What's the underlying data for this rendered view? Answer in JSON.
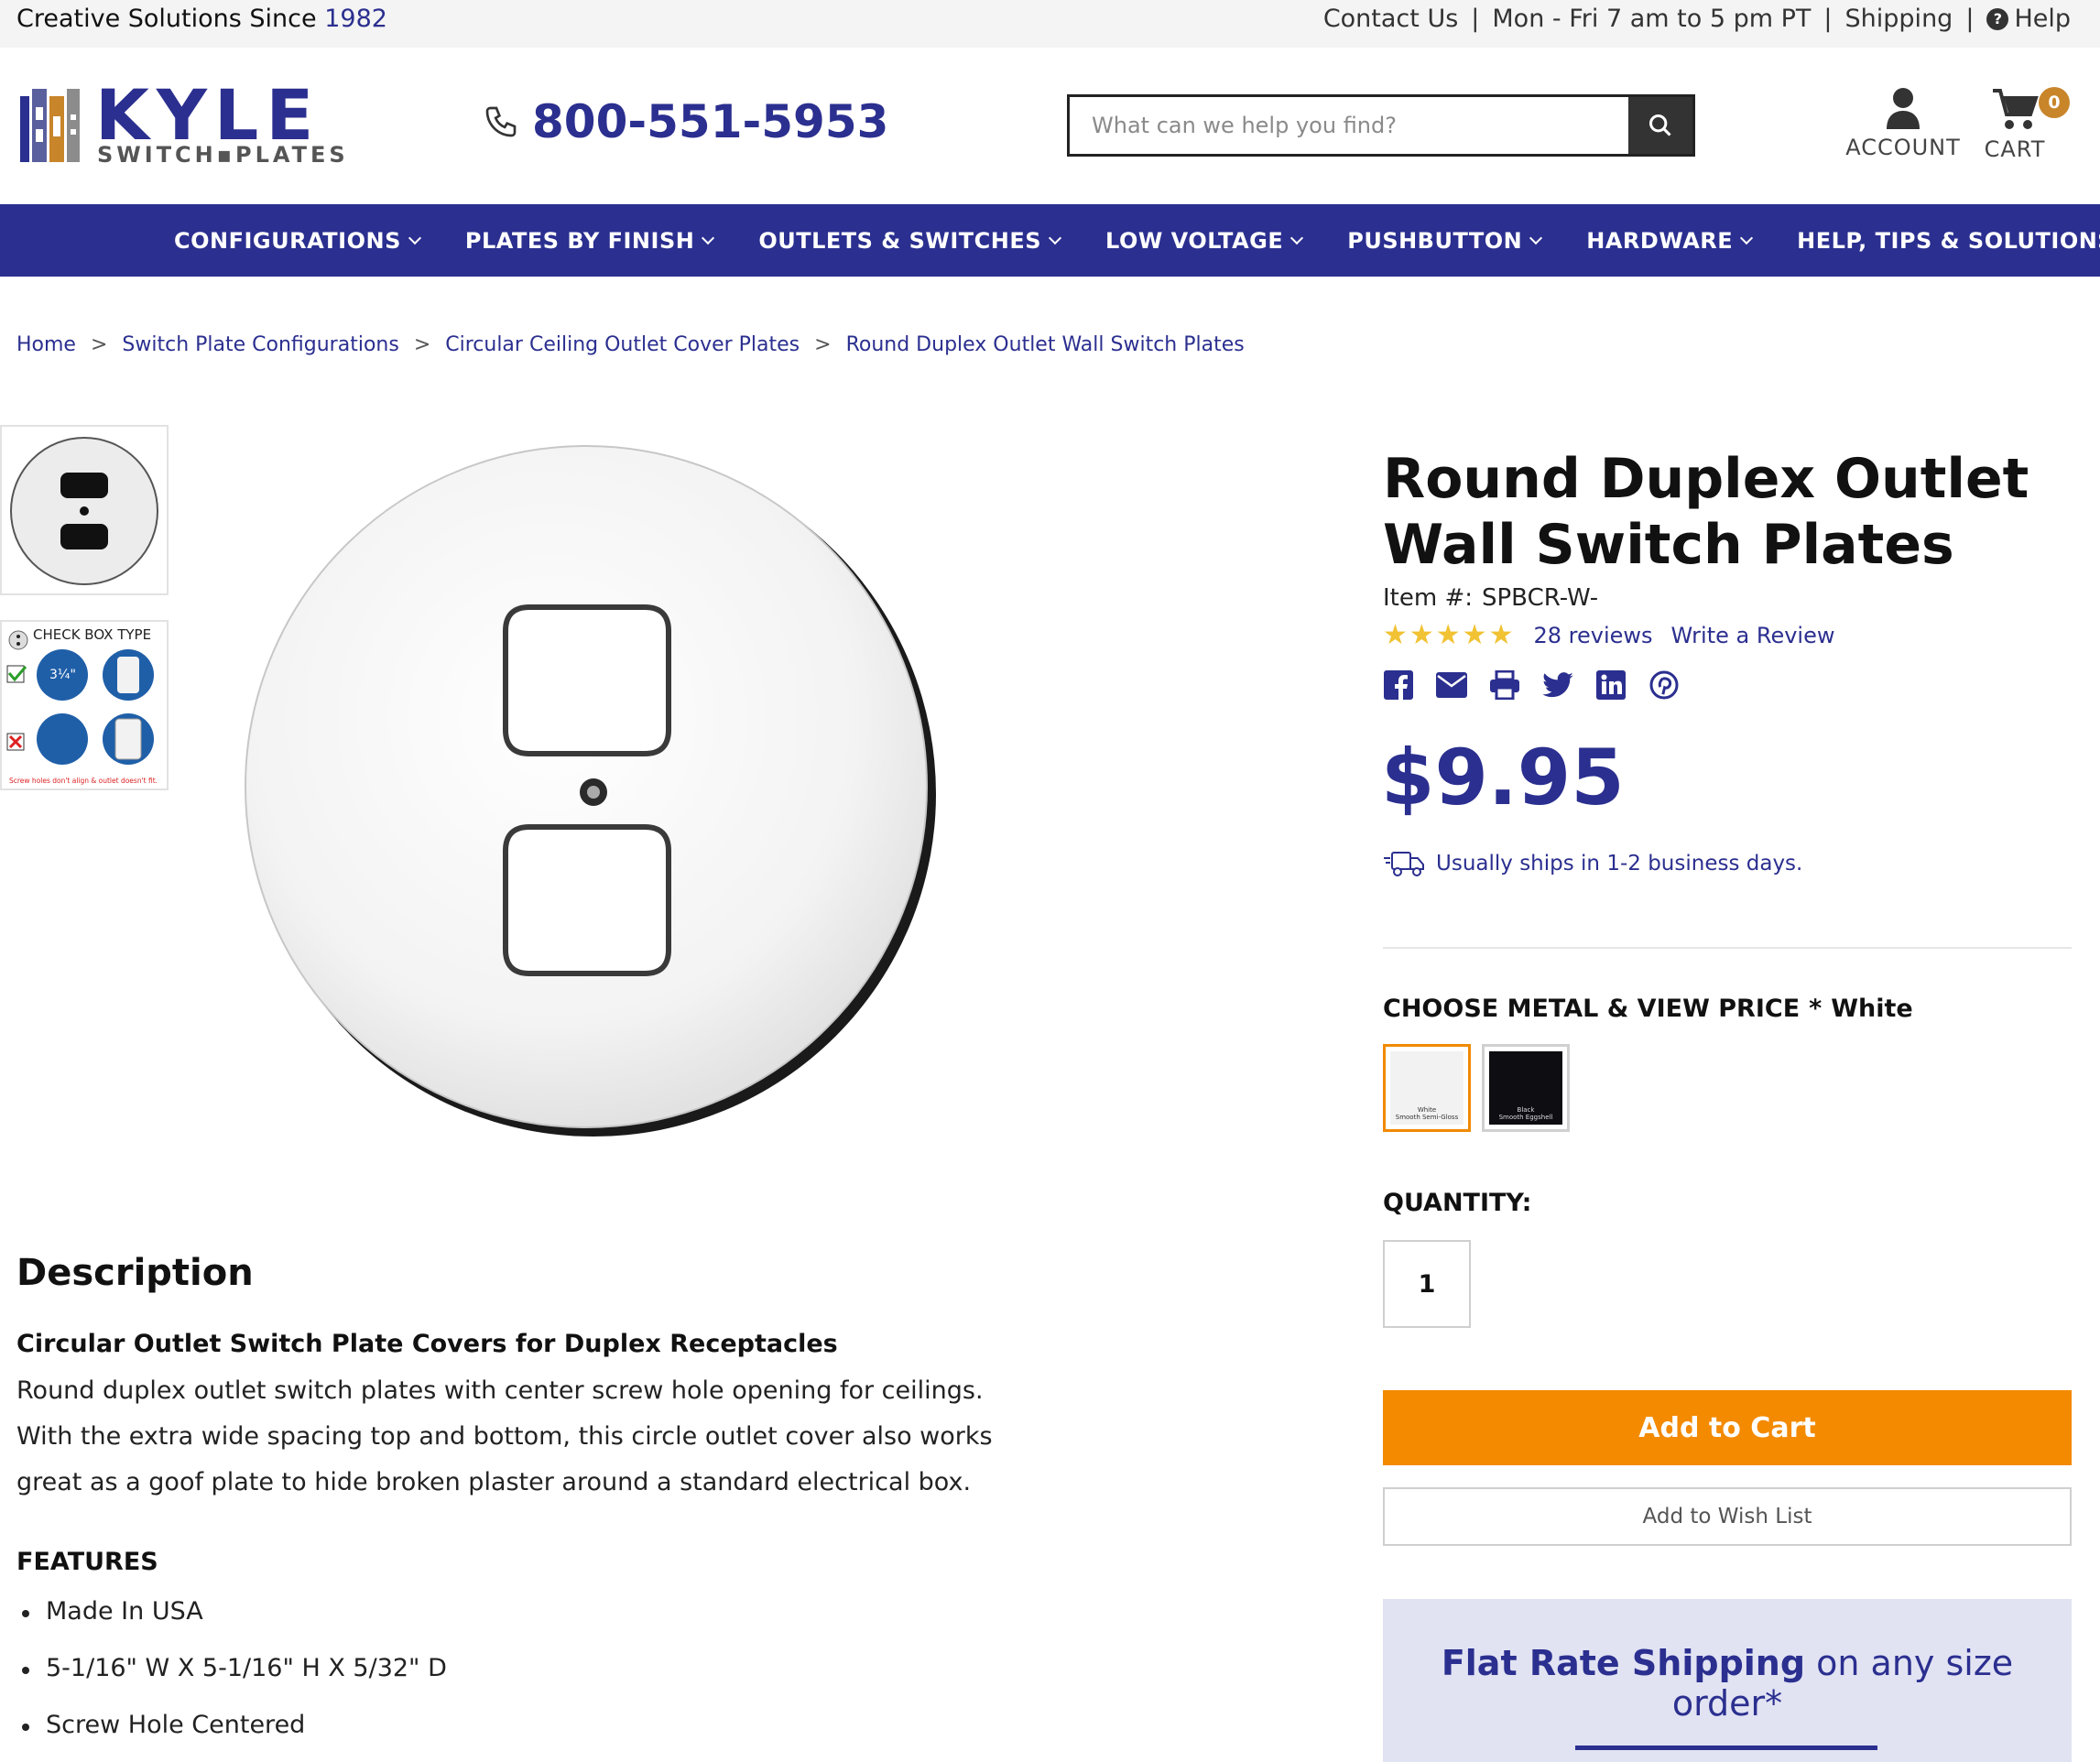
{
  "topbar": {
    "tagline": "Creative Solutions Since",
    "tagline_year": "1982",
    "links": [
      "Contact Us",
      "Mon - Fri 7 am to 5 pm PT",
      "Shipping",
      "Help"
    ],
    "separator": "|"
  },
  "header": {
    "logo_word": "KYLE",
    "logo_sub": "SWITCH▪PLATES",
    "phone": "800-551-5953",
    "search_placeholder": "What can we help you find?",
    "account_label": "ACCOUNT",
    "cart_label": "CART",
    "cart_count": "0"
  },
  "nav": {
    "items": [
      "CONFIGURATIONS",
      "PLATES BY FINISH",
      "OUTLETS & SWITCHES",
      "LOW VOLTAGE",
      "PUSHBUTTON",
      "HARDWARE",
      "HELP, TIPS & SOLUTIONS"
    ]
  },
  "breadcrumb": {
    "items": [
      "Home",
      "Switch Plate Configurations",
      "Circular Ceiling Outlet Cover Plates",
      "Round Duplex Outlet Wall Switch Plates"
    ],
    "separator": ">"
  },
  "gallery": {
    "thumb2_title": "CHECK BOX TYPE",
    "thumb2_caption": "Screw holes don't align & outlet doesn't fit."
  },
  "product": {
    "title": "Round Duplex Outlet Wall Switch Plates",
    "item_label": "Item #:",
    "item_number": "SPBCR-W-",
    "rating_stars": "★★★★★",
    "reviews_link": "28 reviews",
    "write_review": "Write a Review",
    "price": "$9.95",
    "shipping_note": "Usually ships in 1-2 business days.",
    "option_label": "CHOOSE METAL & VIEW PRICE",
    "option_required": "*",
    "option_selected": "White",
    "swatches": [
      {
        "caption_line1": "White",
        "caption_line2": "Smooth Semi-Gloss",
        "color": "#f2f2f2"
      },
      {
        "caption_line1": "Black",
        "caption_line2": "Smooth Eggshell",
        "color": "#0d0d12"
      }
    ],
    "quantity_label": "QUANTITY:",
    "quantity": "1",
    "add_to_cart": "Add to Cart",
    "add_to_wishlist": "Add to Wish List",
    "promo_bold": "Flat Rate Shipping",
    "promo_rest": "on any size order*"
  },
  "description": {
    "heading": "Description",
    "subheading": "Circular Outlet Switch Plate Covers for Duplex Receptacles",
    "body": "Round duplex outlet switch plates with center screw hole opening for ceilings. With the extra wide spacing top and bottom, this circle outlet cover also works great as a goof plate to hide broken plaster around a standard electrical box.",
    "features_heading": "FEATURES",
    "features": [
      "Made In USA",
      "5-1/16\" W X 5-1/16\" H X 5/32\" D",
      "Screw Hole Centered"
    ]
  },
  "colors": {
    "brand_blue": "#2b2f8f",
    "accent_orange": "#f38a00",
    "star_yellow": "#f1c233",
    "promo_bg": "#e1e3f3"
  }
}
